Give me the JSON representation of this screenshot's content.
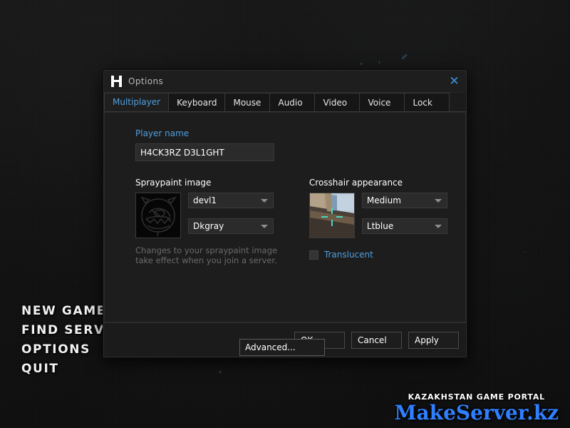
{
  "background": {
    "color": "#121212"
  },
  "main_menu": {
    "items": [
      {
        "label": "NEW GAME"
      },
      {
        "label": "FIND SERVERS"
      },
      {
        "label": "OPTIONS"
      },
      {
        "label": "QUIT"
      }
    ]
  },
  "watermark": {
    "top_line": "KAZAKHSTAN GAME PORTAL",
    "bottom_line": "MakeServer.kz",
    "bottom_color": "#2f7fff"
  },
  "dialog": {
    "title": "Options",
    "logo_icon": "half-life-logo-icon",
    "close_icon": "close-icon",
    "close_glyph": "✕",
    "accent_color": "#4f9fe0",
    "tabs": [
      {
        "label": "Multiplayer",
        "active": true
      },
      {
        "label": "Keyboard",
        "active": false
      },
      {
        "label": "Mouse",
        "active": false
      },
      {
        "label": "Audio",
        "active": false
      },
      {
        "label": "Video",
        "active": false
      },
      {
        "label": "Voice",
        "active": false
      },
      {
        "label": "Lock",
        "active": false
      }
    ],
    "multiplayer": {
      "player_name": {
        "label": "Player name",
        "value": "H4CK3RZ D3L1GHT",
        "placeholder": "Player name"
      },
      "spraypaint": {
        "label": "Spraypaint image",
        "preview_icon": "devil-face-spray-icon",
        "image_select": {
          "value": "devl1",
          "arrow_icon": "chevron-down-icon"
        },
        "color_select": {
          "value": "Dkgray",
          "arrow_icon": "chevron-down-icon"
        },
        "note": "Changes to your spraypaint image take effect when you join a server."
      },
      "crosshair": {
        "label": "Crosshair appearance",
        "preview_icon": "crosshair-preview-icon",
        "size_select": {
          "value": "Medium",
          "arrow_icon": "chevron-down-icon"
        },
        "color_select": {
          "value": "Ltblue",
          "arrow_icon": "chevron-down-icon"
        },
        "translucent": {
          "label": "Translucent",
          "checked": false
        }
      },
      "advanced_button": "Advanced..."
    },
    "footer": {
      "ok": "OK",
      "cancel": "Cancel",
      "apply": "Apply"
    }
  }
}
